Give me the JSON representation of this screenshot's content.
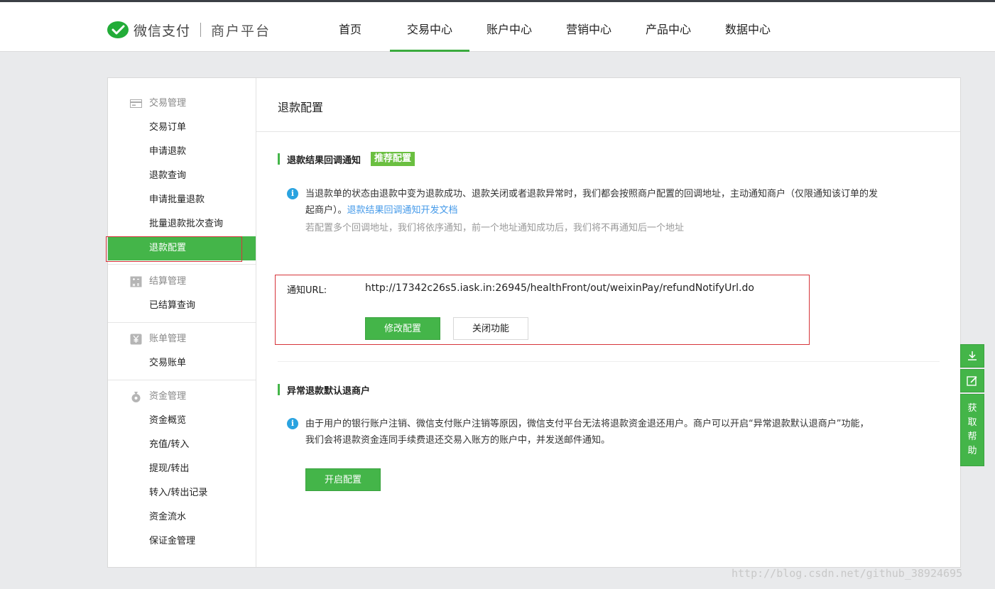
{
  "header": {
    "brand": "微信支付",
    "sub": "商户平台",
    "nav": [
      {
        "label": "首页"
      },
      {
        "label": "交易中心",
        "active": true
      },
      {
        "label": "账户中心"
      },
      {
        "label": "营销中心"
      },
      {
        "label": "产品中心"
      },
      {
        "label": "数据中心"
      }
    ]
  },
  "sidebar": {
    "trade": {
      "title": "交易管理",
      "items": [
        "交易订单",
        "申请退款",
        "退款查询",
        "申请批量退款",
        "批量退款批次查询",
        "退款配置"
      ]
    },
    "settle": {
      "title": "结算管理",
      "items": [
        "已结算查询"
      ]
    },
    "bill": {
      "title": "账单管理",
      "items": [
        "交易账单"
      ]
    },
    "fund": {
      "title": "资金管理",
      "items": [
        "资金概览",
        "充值/转入",
        "提现/转出",
        "转入/转出记录",
        "资金流水",
        "保证金管理"
      ]
    }
  },
  "content": {
    "title": "退款配置",
    "section1": {
      "title": "退款结果回调通知",
      "badge": "推荐配置",
      "text": "当退款单的状态由退款中变为退款成功、退款关闭或者退款异常时，我们都会按照商户配置的回调地址，主动通知商户（仅限通知该订单的发",
      "text2": "起商户）。",
      "link": "退款结果回调通知开发文档",
      "note": "若配置多个回调地址，我们将依序通知，前一个地址通知成功后，我们将不再通知后一个地址",
      "url_label": "通知URL:",
      "url_value": "http://17342c26s5.iask.in:26945/healthFront/out/weixinPay/refundNotifyUrl.do",
      "btn_modify": "修改配置",
      "btn_close": "关闭功能"
    },
    "section2": {
      "title": "异常退款默认退商户",
      "text": "由于用户的银行账户注销、微信支付账户注销等原因，微信支付平台无法将退款资金退还用户。商户可以开启“异常退款默认退商户”功能，",
      "text2": "我们会将退款资金连同手续费退还交易入账方的账户中，并发送邮件通知。",
      "btn_enable": "开启配置"
    }
  },
  "float": {
    "help": [
      "获",
      "取",
      "帮",
      "助"
    ]
  },
  "watermark": "http://blog.csdn.net/github_38924695",
  "colors": {
    "accent": "#44b549",
    "link": "#459ae9",
    "info": "#2aa3e0",
    "highlight": "#d6343a"
  }
}
